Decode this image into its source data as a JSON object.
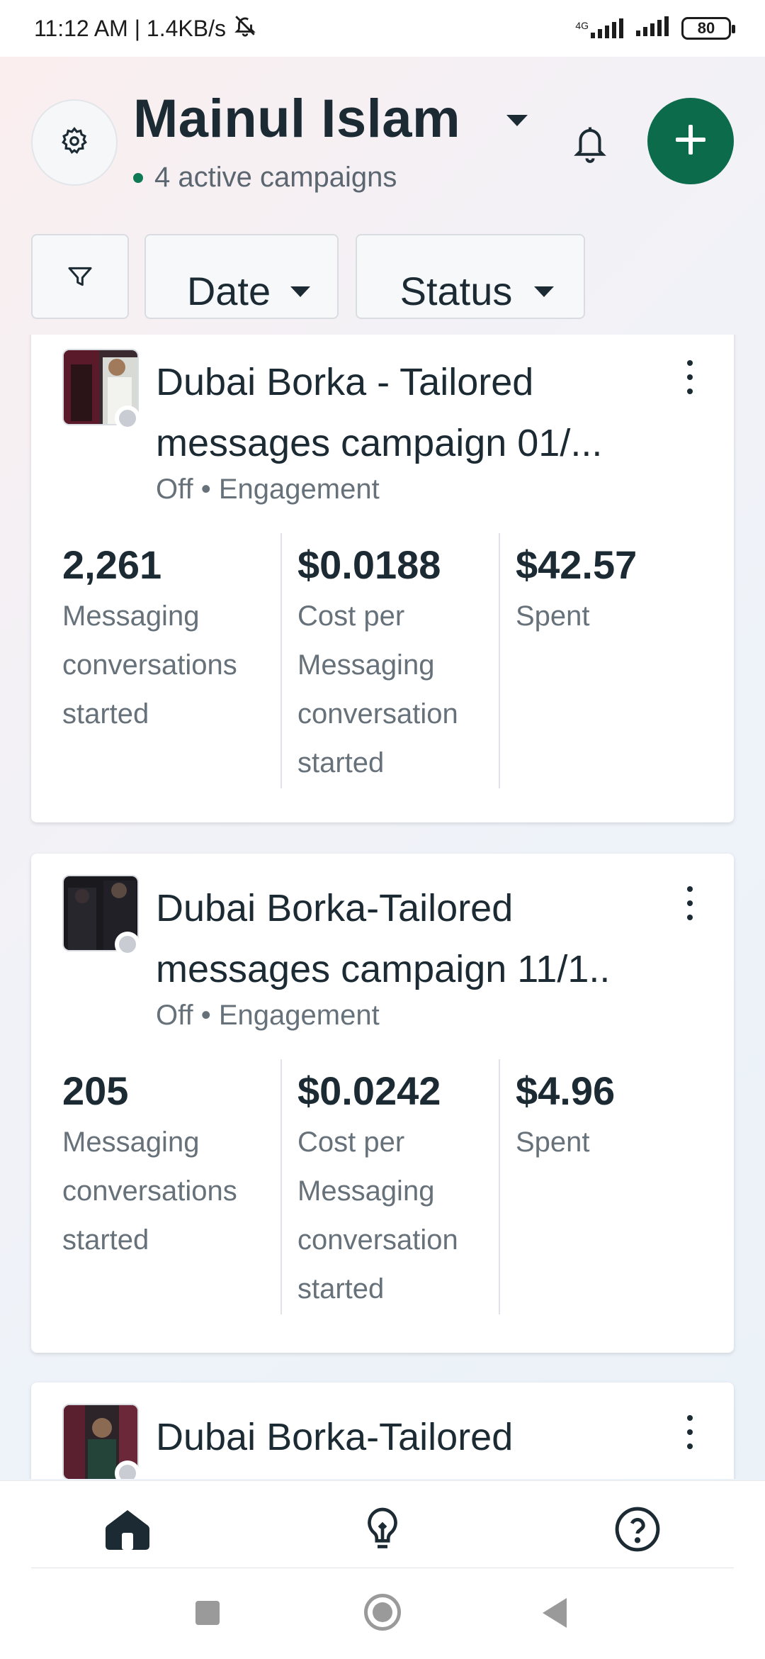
{
  "status_bar": {
    "time": "11:12 AM | 1.4KB/s",
    "network": "4G",
    "battery": "80"
  },
  "header": {
    "account_name": "Mainul Islam",
    "active_campaigns": "4 active campaigns",
    "active_dot_color": "#0e7a55",
    "add_button_color": "#0c6b4a"
  },
  "filters": {
    "date_label": "Date",
    "status_label": "Status"
  },
  "campaigns": [
    {
      "title": "Dubai Borka - Tailored messages campaign 01/...",
      "subtitle": "Off • Engagement",
      "metrics": [
        {
          "value": "2,261",
          "label": "Messaging conversations started"
        },
        {
          "value": "$0.0188",
          "label": "Cost per Messaging conversation started"
        },
        {
          "value": "$42.57",
          "label": "Spent"
        }
      ]
    },
    {
      "title": "Dubai Borka-Tailored messages campaign 11/1..",
      "subtitle": "Off • Engagement",
      "metrics": [
        {
          "value": "205",
          "label": "Messaging conversations started"
        },
        {
          "value": "$0.0242",
          "label": "Cost per Messaging conversation started"
        },
        {
          "value": "$4.96",
          "label": "Spent"
        }
      ]
    },
    {
      "title": "Dubai Borka-Tailored",
      "subtitle": "",
      "metrics": []
    }
  ],
  "icons": {
    "settings": "gear-icon",
    "caret": "caret-down-icon",
    "notifications": "bell-icon",
    "add": "plus-icon",
    "filter": "filter-icon",
    "more": "more-vertical-icon",
    "home": "home-icon",
    "ideas": "lightbulb-icon",
    "help": "help-icon"
  }
}
